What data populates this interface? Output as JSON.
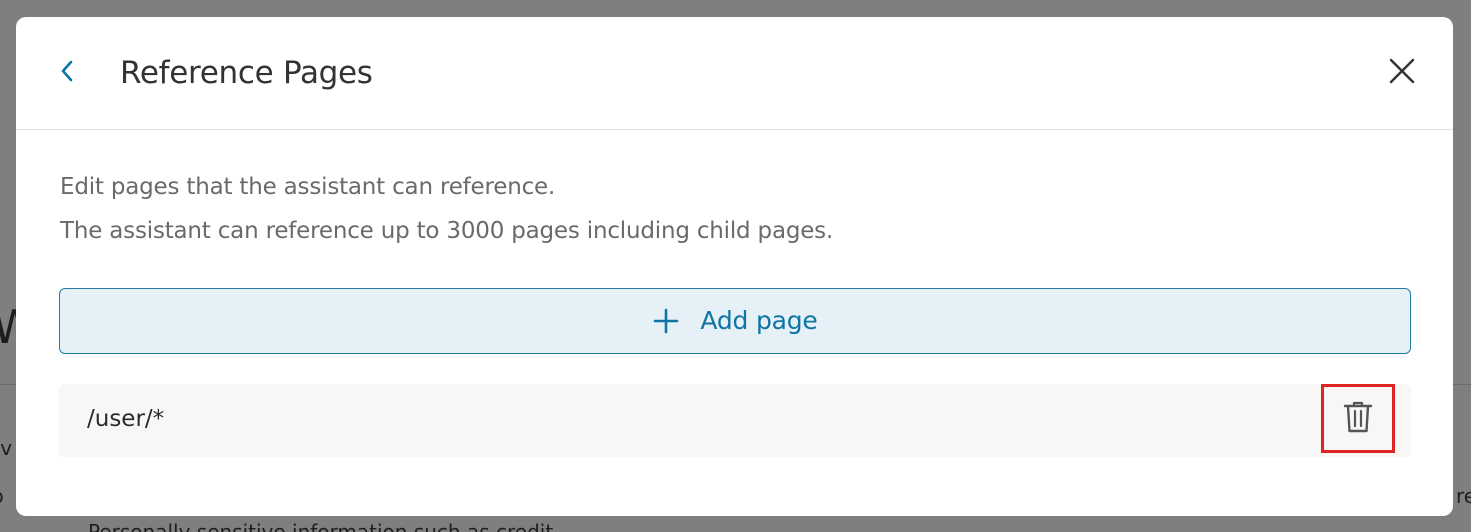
{
  "background": {
    "heading_fragment": "We",
    "line1_fragment": "ov",
    "line2_fragment": "lo",
    "line3_fragment": "Personally sensitive information such as credit",
    "right_fragment": "re"
  },
  "modal": {
    "title": "Reference Pages",
    "description_line1": "Edit pages that the assistant can reference.",
    "description_line2": "The assistant can reference up to 3000 pages including child pages.",
    "add_page_label": "Add page",
    "pages": [
      {
        "path": "/user/*"
      }
    ]
  },
  "icons": {
    "back": "chevron-left-icon",
    "close": "close-icon",
    "add": "plus-icon",
    "delete": "trash-icon"
  },
  "colors": {
    "accent": "#0f75a5",
    "accent_bg": "#e5f0f7",
    "highlight": "#e02424"
  }
}
